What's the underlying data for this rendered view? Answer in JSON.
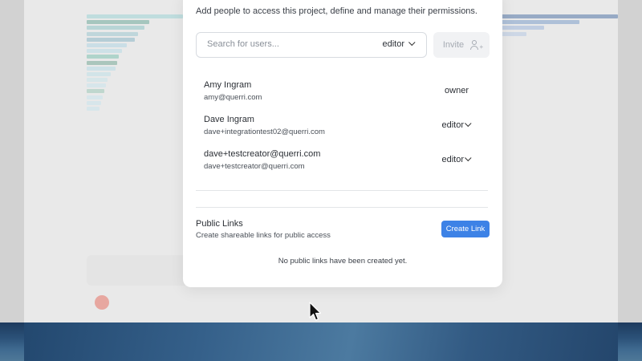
{
  "dialog": {
    "intro": "Add people to access this project, define and manage their permissions.",
    "search": {
      "placeholder": "Search for users...",
      "role": "editor"
    },
    "invite_label": "Invite",
    "members": [
      {
        "name": "Amy Ingram",
        "email": "amy@querri.com",
        "role": "owner"
      },
      {
        "name": "Dave Ingram",
        "email": "dave+integrationtest02@querri.com",
        "role": "editor"
      },
      {
        "name": "dave+testcreator@querri.com",
        "email": "dave+testcreator@querri.com",
        "role": "editor"
      }
    ],
    "public_links": {
      "title": "Public Links",
      "subtitle": "Create shareable links for public access",
      "create_label": "Create Link",
      "empty_message": "No public links have been created yet."
    }
  },
  "colors": {
    "accent": "#3d82e6"
  }
}
